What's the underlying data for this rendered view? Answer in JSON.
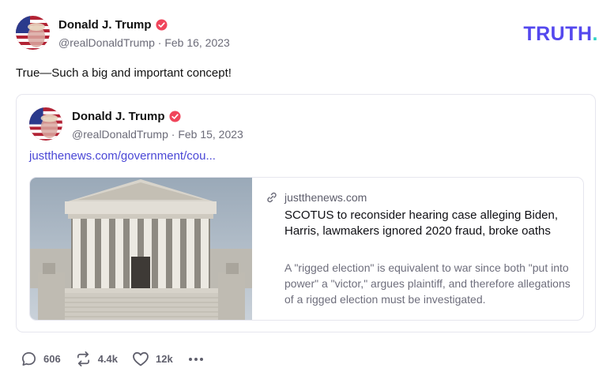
{
  "brand": {
    "logo_text": "TRUTH",
    "logo_dot": "."
  },
  "post": {
    "author_name": "Donald J. Trump",
    "handle": "@realDonaldTrump",
    "date": "Feb 16, 2023",
    "text": "True—Such a big and important concept!"
  },
  "quoted": {
    "author_name": "Donald J. Trump",
    "handle": "@realDonaldTrump",
    "date": "Feb 15, 2023",
    "link_text": "justthenews.com/government/cou...",
    "card": {
      "domain": "justthenews.com",
      "title": "SCOTUS to reconsider hearing case alleging Biden, Harris, lawmakers ignored 2020 fraud, broke oaths",
      "description": "A \"rigged election\" is equivalent to war since both \"put into power\" a \"victor,\" argues plaintiff, and therefore allegations of a rigged election must be investigated."
    }
  },
  "actions": {
    "replies": "606",
    "retruths": "4.4k",
    "likes": "12k"
  },
  "icons": {
    "verified": "verified-badge-icon",
    "link": "link-icon",
    "reply": "reply-icon",
    "retruth": "retruth-icon",
    "like": "heart-icon",
    "more": "more-icon"
  },
  "colors": {
    "brand": "#5448ee",
    "brand_dot": "#2fd1c4",
    "link": "#4a47d6",
    "verified": "#f0455b"
  }
}
